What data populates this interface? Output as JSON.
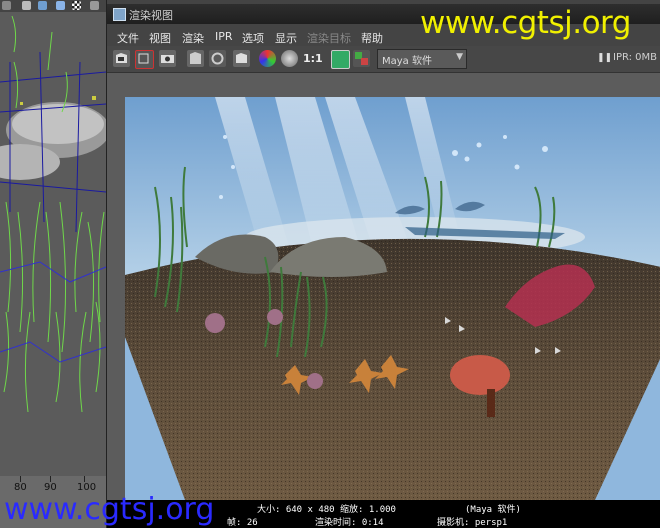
{
  "app": {
    "window_title": "渲染视图"
  },
  "menu": {
    "items": [
      {
        "label": "文件",
        "enabled": true
      },
      {
        "label": "视图",
        "enabled": true
      },
      {
        "label": "渲染",
        "enabled": true
      },
      {
        "label": "IPR",
        "enabled": true
      },
      {
        "label": "选项",
        "enabled": true
      },
      {
        "label": "显示",
        "enabled": true
      },
      {
        "label": "渲染目标",
        "enabled": false
      },
      {
        "label": "帮助",
        "enabled": true
      }
    ]
  },
  "toolbar": {
    "icons": [
      "redo-render-icon",
      "redo-region-icon",
      "snapshot-icon",
      "ipr-render-icon",
      "refresh-icon",
      "keep-image-icon",
      "rgb-channels-icon",
      "alpha-channel-icon",
      "real-size-icon",
      "frame-image-icon",
      "frame-region-icon"
    ],
    "zoom_label": "1:1",
    "renderer": "Maya 软件",
    "ipr_memory": "IPR: 0MB"
  },
  "ruler": {
    "labels": [
      "80",
      "90",
      "100"
    ]
  },
  "status": {
    "size": "大小: 640 x 480  缩放: 1.000",
    "renderer": "(Maya 软件)",
    "frame": "帧: 26",
    "render_time": "渲染时间: 0:14",
    "camera": "摄影机: persp1"
  },
  "watermark": {
    "top": "www.cgtsj.org",
    "bottom": "www.cgtsj.org"
  },
  "colors": {
    "watermark_top": "#f0f000",
    "watermark_bottom": "#2a2aff",
    "water": "#8fb7dd",
    "sand": "#5a4a36"
  }
}
